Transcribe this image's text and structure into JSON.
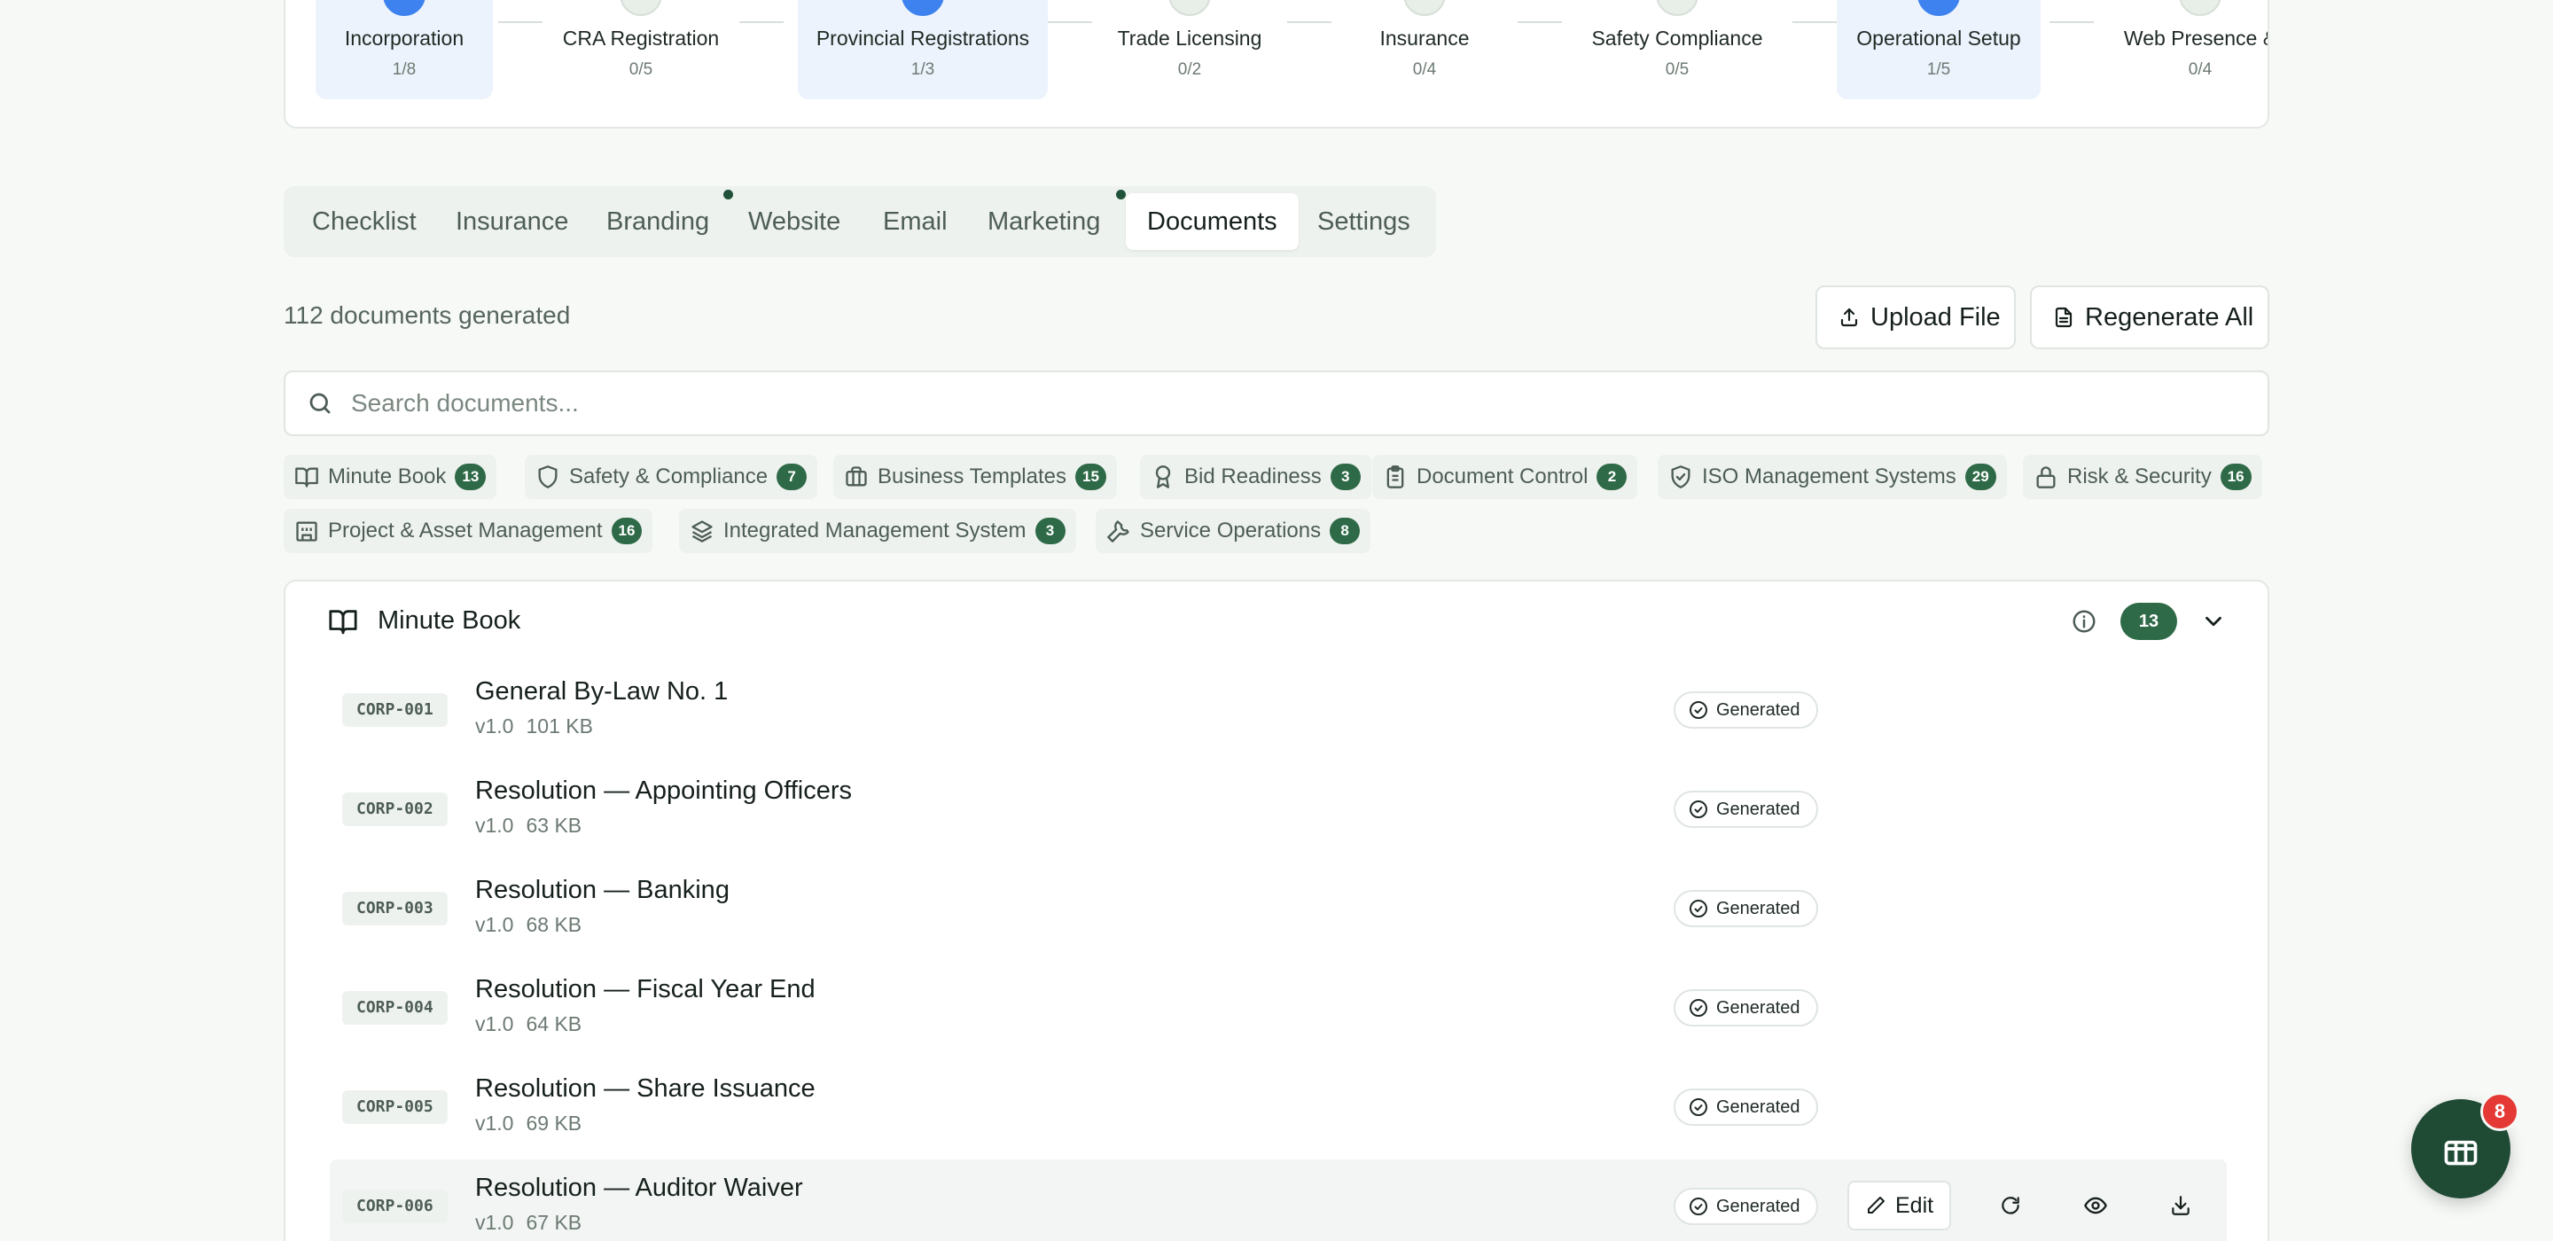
{
  "stepper": [
    {
      "name": "Incorporation",
      "count": "1/8",
      "active": true
    },
    {
      "name": "CRA Registration",
      "count": "0/5",
      "active": false
    },
    {
      "name": "Provincial Registrations",
      "count": "1/3",
      "active": true
    },
    {
      "name": "Trade Licensing",
      "count": "0/2",
      "active": false
    },
    {
      "name": "Insurance",
      "count": "0/4",
      "active": false
    },
    {
      "name": "Safety Compliance",
      "count": "0/5",
      "active": false
    },
    {
      "name": "Operational Setup",
      "count": "1/5",
      "active": true
    },
    {
      "name": "Web Presence &",
      "count": "0/4",
      "active": false
    }
  ],
  "tabs": [
    {
      "label": "Checklist"
    },
    {
      "label": "Insurance"
    },
    {
      "label": "Branding"
    },
    {
      "label": "Website"
    },
    {
      "label": "Email"
    },
    {
      "label": "Marketing"
    },
    {
      "label": "Documents",
      "active": true
    },
    {
      "label": "Settings"
    }
  ],
  "summary": "112 documents generated",
  "actions": {
    "upload": "Upload File",
    "regenerate": "Regenerate All"
  },
  "search": {
    "placeholder": "Search documents..."
  },
  "categories": [
    {
      "label": "Minute Book",
      "count": "13",
      "icon": "book-open-icon"
    },
    {
      "label": "Safety & Compliance",
      "count": "7",
      "icon": "shield-icon"
    },
    {
      "label": "Business Templates",
      "count": "15",
      "icon": "briefcase-icon"
    },
    {
      "label": "Bid Readiness",
      "count": "3",
      "icon": "award-icon"
    },
    {
      "label": "Document Control",
      "count": "2",
      "icon": "clipboard-icon"
    },
    {
      "label": "ISO Management Systems",
      "count": "29",
      "icon": "shield-check-icon"
    },
    {
      "label": "Risk & Security",
      "count": "16",
      "icon": "lock-icon"
    },
    {
      "label": "Project & Asset Management",
      "count": "16",
      "icon": "building-icon"
    },
    {
      "label": "Integrated Management System",
      "count": "3",
      "icon": "layers-icon"
    },
    {
      "label": "Service Operations",
      "count": "8",
      "icon": "wrench-icon"
    }
  ],
  "panel": {
    "title": "Minute Book",
    "count": "13",
    "documents": [
      {
        "code": "CORP-001",
        "title": "General By-Law No. 1",
        "version": "v1.0",
        "size": "101 KB",
        "status": "Generated"
      },
      {
        "code": "CORP-002",
        "title": "Resolution — Appointing Officers",
        "version": "v1.0",
        "size": "63 KB",
        "status": "Generated"
      },
      {
        "code": "CORP-003",
        "title": "Resolution — Banking",
        "version": "v1.0",
        "size": "68 KB",
        "status": "Generated"
      },
      {
        "code": "CORP-004",
        "title": "Resolution — Fiscal Year End",
        "version": "v1.0",
        "size": "64 KB",
        "status": "Generated"
      },
      {
        "code": "CORP-005",
        "title": "Resolution — Share Issuance",
        "version": "v1.0",
        "size": "69 KB",
        "status": "Generated"
      },
      {
        "code": "CORP-006",
        "title": "Resolution — Auditor Waiver",
        "version": "v1.0",
        "size": "67 KB",
        "status": "Generated"
      }
    ],
    "edit_label": "Edit"
  },
  "fab": {
    "badge": "8",
    "icon": "gift-icon"
  },
  "colors": {
    "accent": "#2e6a47",
    "active_step": "#3d82ee",
    "notification": "#e53935"
  }
}
